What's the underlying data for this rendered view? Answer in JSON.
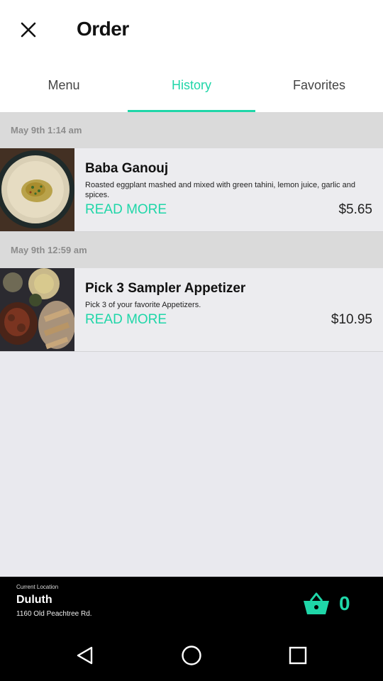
{
  "header": {
    "title": "Order",
    "close_icon": "close-icon"
  },
  "tabs": [
    {
      "label": "Menu",
      "active": false
    },
    {
      "label": "History",
      "active": true
    },
    {
      "label": "Favorites",
      "active": false
    }
  ],
  "history": [
    {
      "date": "May 9th 1:14 am",
      "item": {
        "name": "Baba Ganouj",
        "description": "Roasted eggplant mashed and mixed with green tahini, lemon juice, garlic and spices.",
        "read_more": "READ MORE",
        "price": "$5.65"
      }
    },
    {
      "date": "May 9th 12:59 am",
      "item": {
        "name": "Pick 3 Sampler Appetizer",
        "description": "Pick 3 of your favorite Appetizers.",
        "read_more": "READ MORE",
        "price": "$10.95"
      }
    }
  ],
  "location": {
    "caption": "Current Location",
    "city": "Duluth",
    "address": "1160 Old Peachtree Rd."
  },
  "cart": {
    "count": "0",
    "icon": "basket-icon"
  },
  "colors": {
    "accent": "#1fd6a8",
    "bar": "#000000"
  },
  "nav": [
    "back-icon",
    "home-icon",
    "recents-icon"
  ]
}
